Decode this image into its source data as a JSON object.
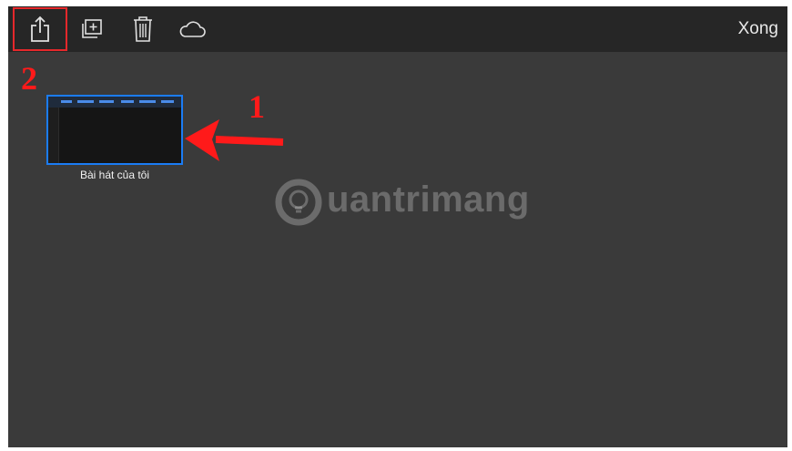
{
  "toolbar": {
    "done_label": "Xong",
    "icons": [
      "share-icon",
      "new-project-icon",
      "trash-icon",
      "cloud-icon"
    ]
  },
  "annotations": {
    "step_1": "1",
    "step_2": "2"
  },
  "project": {
    "title": "Bài hát của tôi"
  },
  "watermark": {
    "text": "uantrimang"
  },
  "colors": {
    "toolbar_bg": "#262626",
    "background": "#3a3a3a",
    "selection_border": "#1b7cf4",
    "annotation_red": "#e5282b"
  }
}
